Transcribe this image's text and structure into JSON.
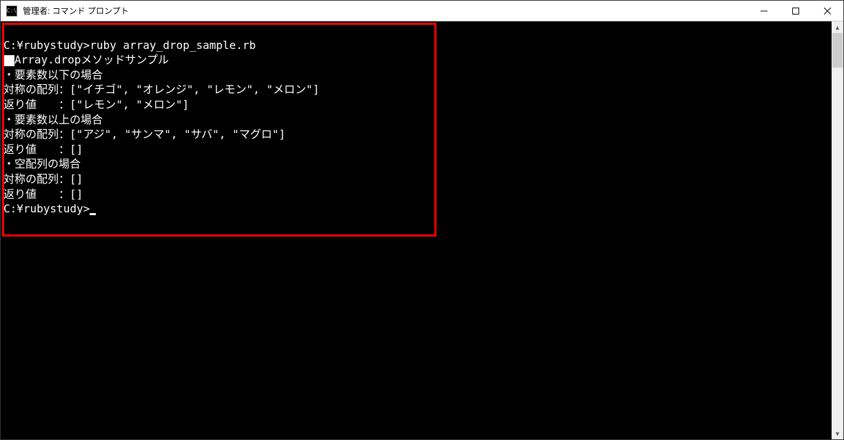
{
  "titlebar": {
    "icon_label": "C:\\",
    "title": "管理者: コマンド プロンプト"
  },
  "terminal": {
    "command_line": "C:¥rubystudy>ruby array_drop_sample.rb",
    "header": "Array.dropメソッドサンプル",
    "blank": "",
    "section1_title": "・要素数以下の場合",
    "section1_array": "対称の配列：[\"イチゴ\", \"オレンジ\", \"レモン\", \"メロン\"]",
    "section1_return": "返り値　　：[\"レモン\", \"メロン\"]",
    "section2_title": "・要素数以上の場合",
    "section2_array": "対称の配列：[\"アジ\", \"サンマ\", \"サバ\", \"マグロ\"]",
    "section2_return": "返り値　　：[]",
    "section3_title": "・空配列の場合",
    "section3_array": "対称の配列：[]",
    "section3_return": "返り値　　：[]",
    "prompt": "C:¥rubystudy>"
  }
}
